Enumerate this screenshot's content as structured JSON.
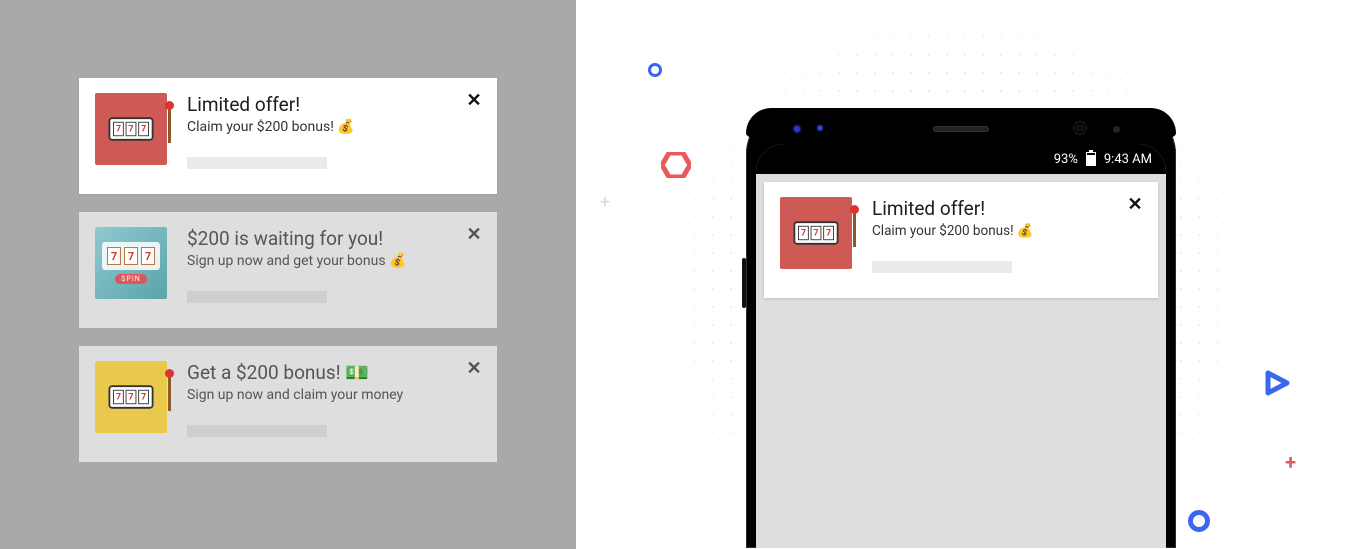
{
  "close_glyph": "✕",
  "notifications": [
    {
      "title": "Limited offer!",
      "subtitle": "Claim your $200 bonus! 💰",
      "icon_bg": "red",
      "levered": true
    },
    {
      "title": "$200 is waiting for you!",
      "subtitle": "Sign up now and get your bonus 💰",
      "icon_bg": "teal",
      "spin_label": "SPIN"
    },
    {
      "title": "Get a $200 bonus! 💵",
      "subtitle": "Sign up now and claim your money",
      "icon_bg": "yellow",
      "levered": true
    }
  ],
  "phone": {
    "status": {
      "battery_pct": "93%",
      "time": "9:43 AM"
    },
    "notification": {
      "title": "Limited offer!",
      "subtitle": "Claim your $200 bonus! 💰"
    }
  },
  "slot_digits": [
    "7",
    "7",
    "7"
  ]
}
